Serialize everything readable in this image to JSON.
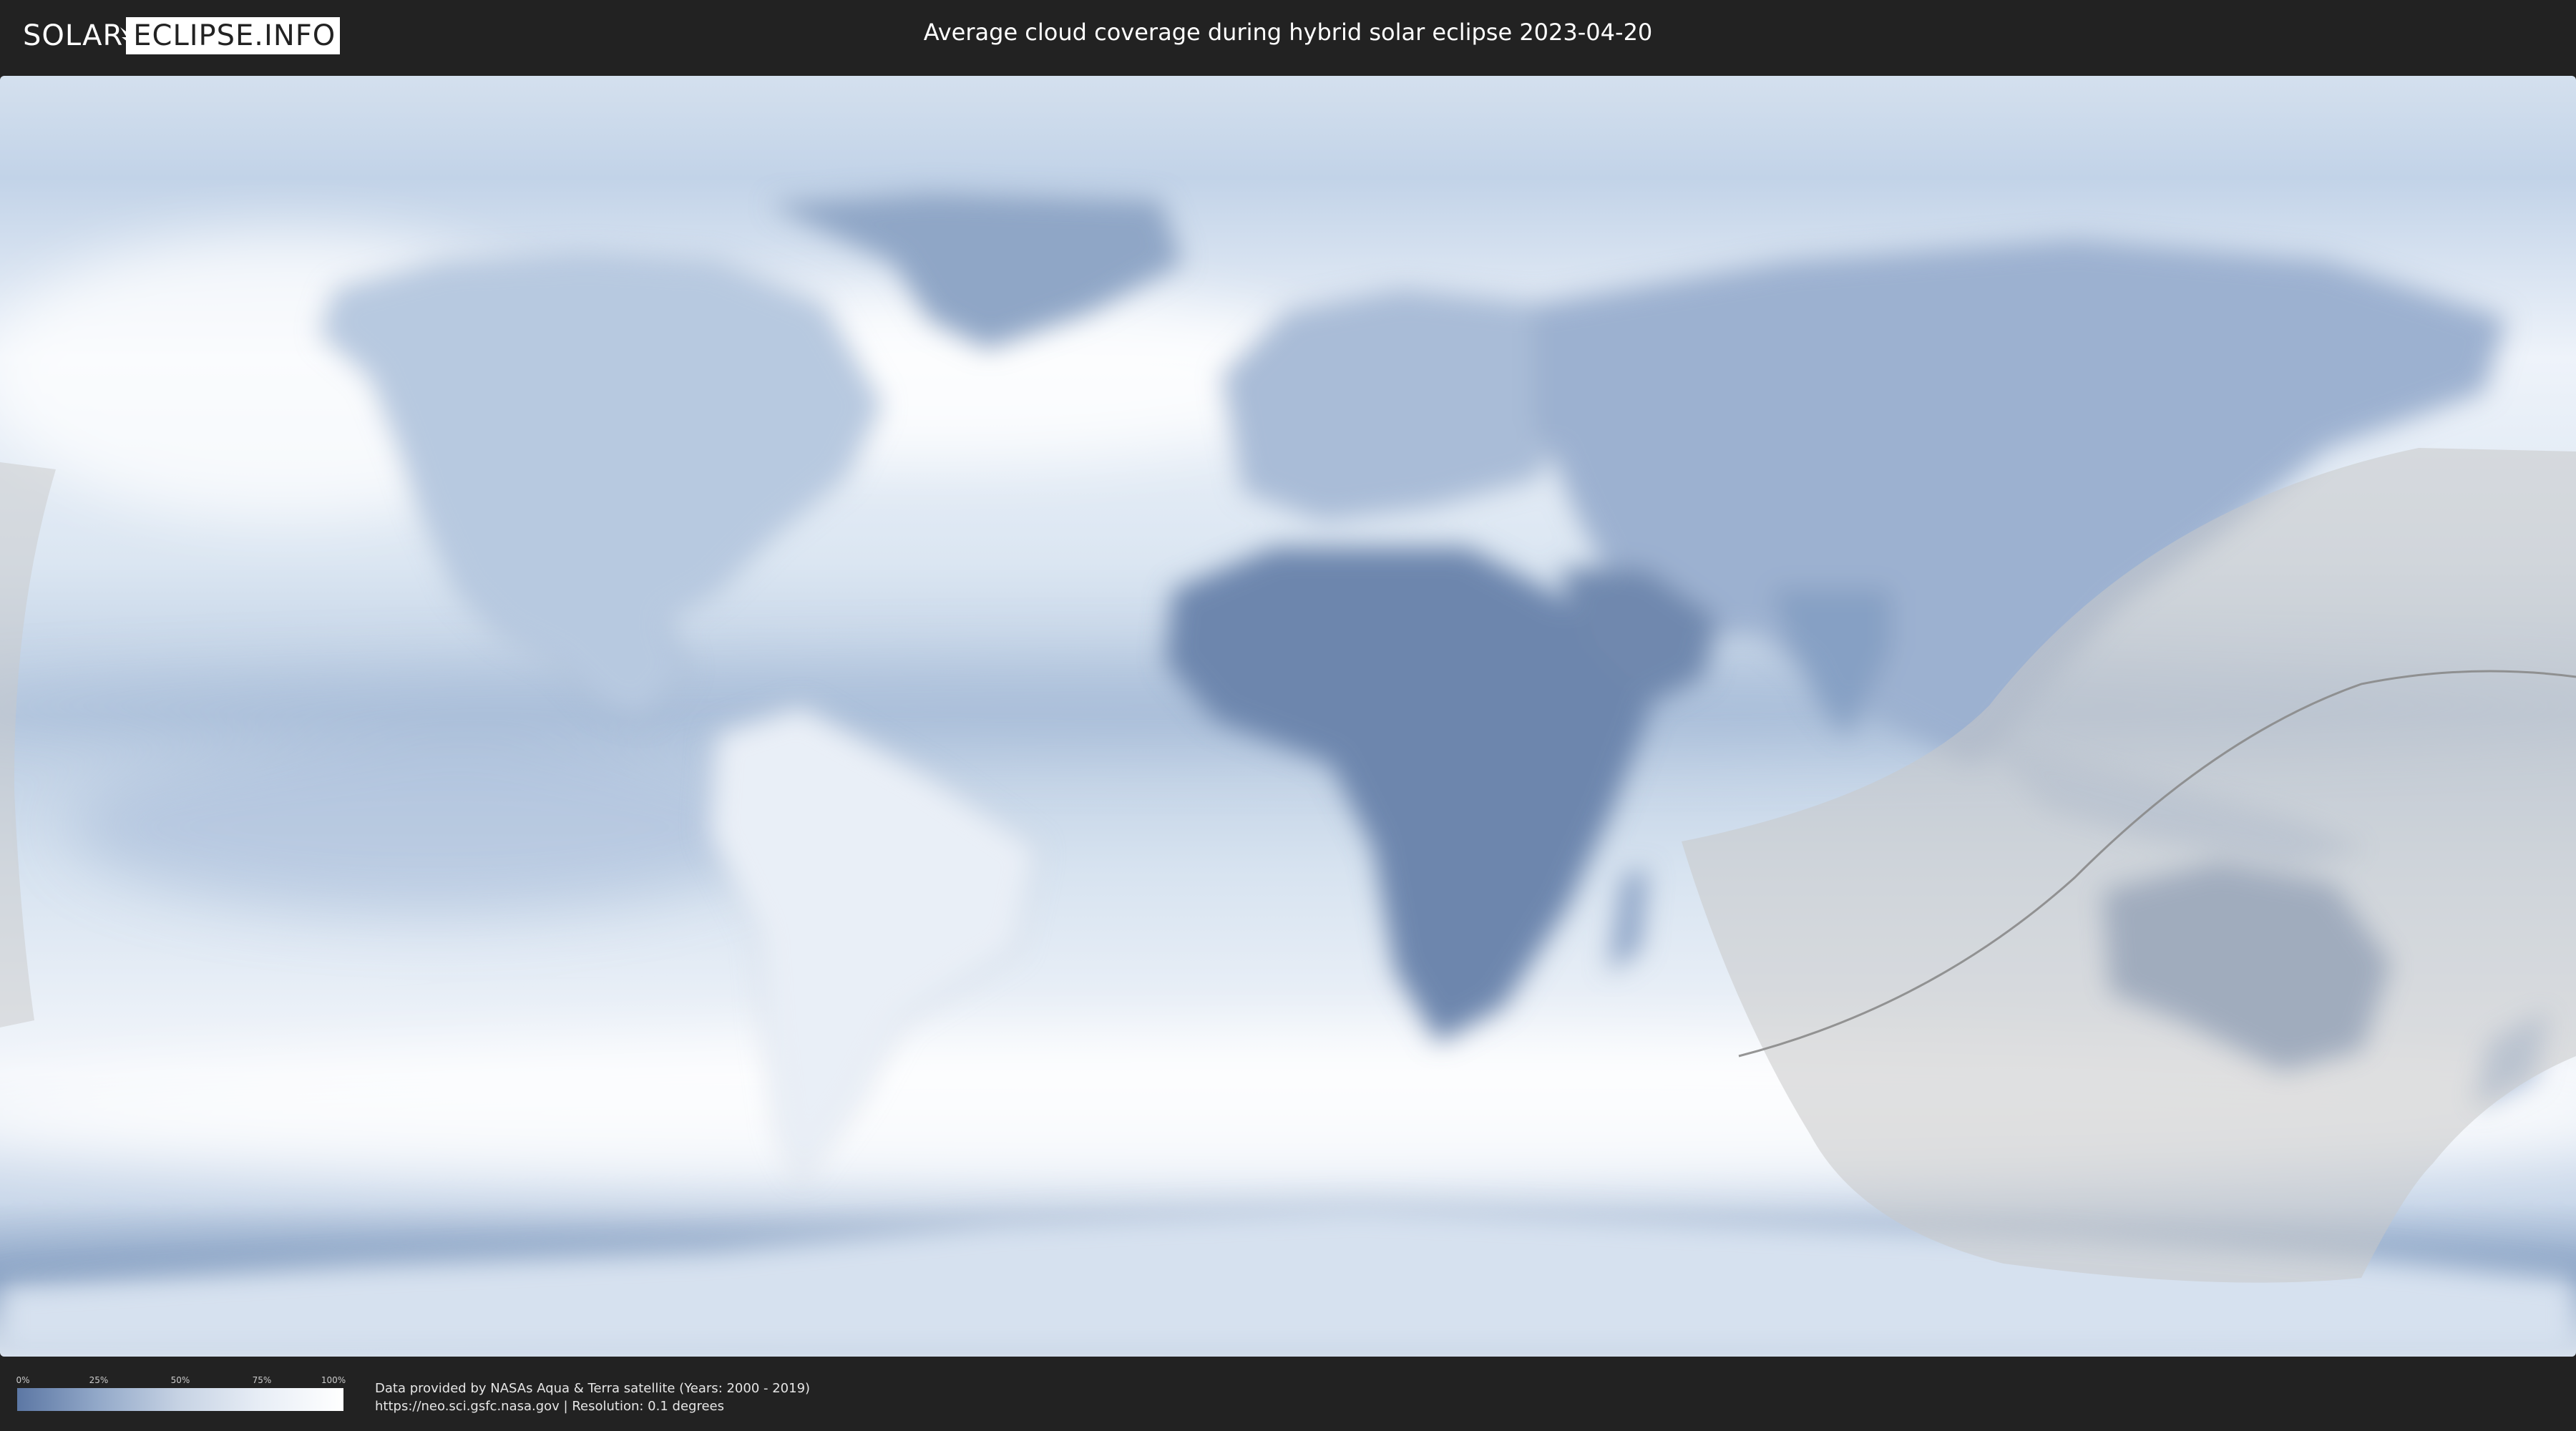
{
  "header": {
    "logo_left": "SOLAR",
    "logo_right": "ECLIPSE.INFO",
    "title": "Average cloud coverage during hybrid solar eclipse 2023-04-20"
  },
  "legend": {
    "ticks": [
      "0%",
      "25%",
      "50%",
      "75%",
      "100%"
    ],
    "gradient_colors": [
      "#5c77a4",
      "#93a9c9",
      "#c7d3e4",
      "#e8eef6",
      "#ffffff"
    ]
  },
  "credits": {
    "line1": "Data provided by NASAs Aqua & Terra satellite (Years: 2000 - 2019)",
    "line2": "https://neo.sci.gsfc.nasa.gov | Resolution: 0.1 degrees"
  },
  "colors": {
    "background": "#222222",
    "clear_sky": "#5c77a4",
    "cloudy": "#ffffff",
    "eclipse_overlay": "#bdbdbd"
  }
}
